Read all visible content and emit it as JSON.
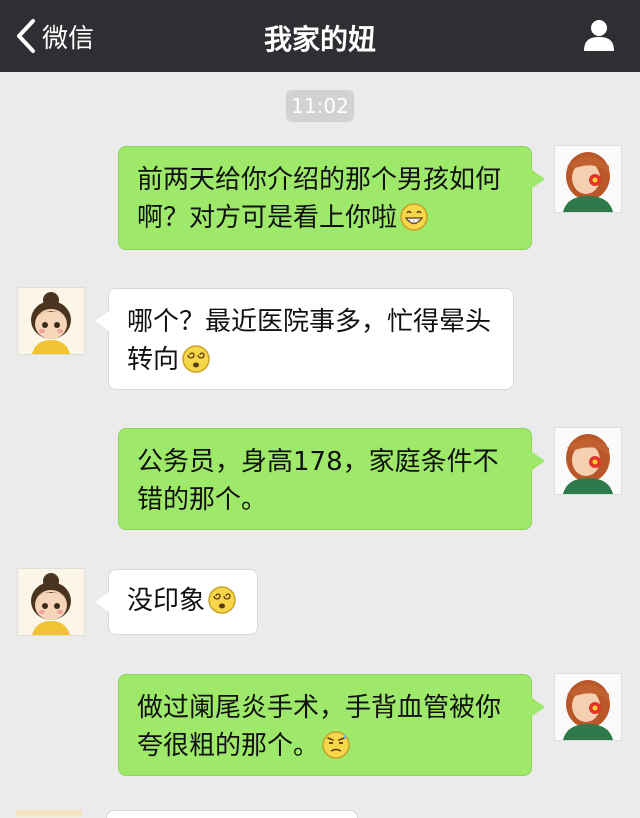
{
  "header": {
    "back_label": "微信",
    "title": "我家的妞"
  },
  "timestamp": "11:02",
  "messages": [
    {
      "side": "me",
      "text": "前两天给你介绍的那个男孩如何啊？对方可是看上你啦",
      "emoji": "grinning-face"
    },
    {
      "side": "other",
      "text": "哪个？最近医院事多，忙得晕头转向",
      "emoji": "dizzy-face"
    },
    {
      "side": "me",
      "text": "公务员，身高178，家庭条件不错的那个。",
      "emoji": ""
    },
    {
      "side": "other",
      "text": "没印象",
      "emoji": "dizzy-face"
    },
    {
      "side": "me",
      "text": "做过阑尾炎手术，手背血管被你夸很粗的那个。",
      "emoji": "unamused-face"
    }
  ],
  "colors": {
    "topbar": "#2e2f33",
    "chat_background": "#ebebeb",
    "my_bubble": "#9ee86a",
    "other_bubble": "#ffffff"
  }
}
